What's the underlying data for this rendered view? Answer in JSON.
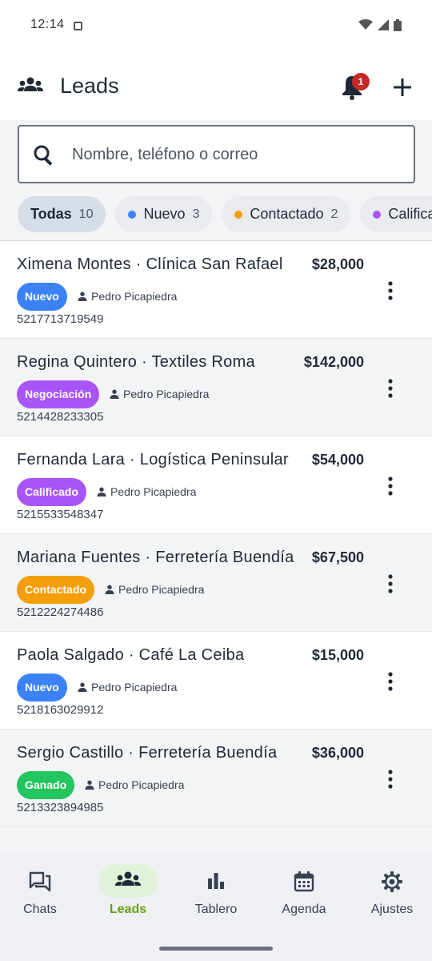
{
  "status_bar": {
    "time": "12:14"
  },
  "app_bar": {
    "title": "Leads",
    "notification_count": "1"
  },
  "search": {
    "placeholder": "Nombre, teléfono o correo"
  },
  "filters": [
    {
      "label": "Todas",
      "count": "10",
      "color": ""
    },
    {
      "label": "Nuevo",
      "count": "3",
      "color": "#3b82f6"
    },
    {
      "label": "Contactado",
      "count": "2",
      "color": "#f59e0b"
    },
    {
      "label": "Calificado",
      "count": "",
      "color": "#a855f7"
    }
  ],
  "leads": [
    {
      "name": "Ximena Montes · Clínica San Rafael",
      "amount": "$28,000",
      "status": "Nuevo",
      "status_color": "#3b82f6",
      "owner": "Pedro Picapiedra",
      "phone": "5217713719549"
    },
    {
      "name": "Regina Quintero · Textiles Roma",
      "amount": "$142,000",
      "status": "Negociación",
      "status_color": "#a855f7",
      "owner": "Pedro Picapiedra",
      "phone": "5214428233305"
    },
    {
      "name": "Fernanda Lara · Logística Peninsular",
      "amount": "$54,000",
      "status": "Calificado",
      "status_color": "#a855f7",
      "owner": "Pedro Picapiedra",
      "phone": "5215533548347"
    },
    {
      "name": "Mariana Fuentes · Ferretería Buendía",
      "amount": "$67,500",
      "status": "Contactado",
      "status_color": "#f59e0b",
      "owner": "Pedro Picapiedra",
      "phone": "5212224274486"
    },
    {
      "name": "Paola Salgado · Café La Ceiba",
      "amount": "$15,000",
      "status": "Nuevo",
      "status_color": "#3b82f6",
      "owner": "Pedro Picapiedra",
      "phone": "5218163029912"
    },
    {
      "name": "Sergio Castillo · Ferretería Buendía",
      "amount": "$36,000",
      "status": "Ganado",
      "status_color": "#22c55e",
      "owner": "Pedro Picapiedra",
      "phone": "5213323894985"
    }
  ],
  "nav": [
    {
      "label": "Chats",
      "icon": "chat-icon",
      "active": false
    },
    {
      "label": "Leads",
      "icon": "groups-icon",
      "active": true
    },
    {
      "label": "Tablero",
      "icon": "bar-chart-icon",
      "active": false
    },
    {
      "label": "Agenda",
      "icon": "calendar-icon",
      "active": false
    },
    {
      "label": "Ajustes",
      "icon": "gear-icon",
      "active": false
    }
  ],
  "colors": {
    "accent": "#65a30d",
    "badge": "#c62828"
  }
}
